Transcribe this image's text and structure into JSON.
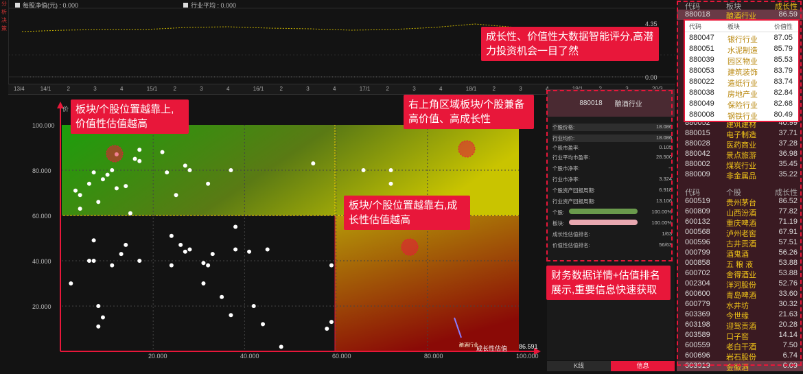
{
  "top_legend": {
    "eps_label": "每股净值(元) : 0.000",
    "avg_label": "行业平均 : 0.000"
  },
  "left_rail": [
    "分",
    "析",
    "决",
    "策"
  ],
  "top_axis_right": [
    "4.35",
    "0.00"
  ],
  "date_axis": [
    "13/4",
    "14/1",
    "2",
    "3",
    "4",
    "15/1",
    "2",
    "3",
    "4",
    "16/1",
    "2",
    "3",
    "4",
    "17/1",
    "2",
    "3",
    "4",
    "18/1",
    "2",
    "3",
    "4",
    "19/1",
    "2",
    "3",
    "20/3"
  ],
  "scatter": {
    "y_axis_title": "价",
    "y_ticks": [
      "100.000",
      "80.000",
      "60.000",
      "40.000",
      "20.000"
    ],
    "x_ticks": [
      "20.000",
      "40.000",
      "60.000",
      "80.000",
      "100.000"
    ],
    "x_axis_title": "成长性估值",
    "x_readout": "86.591",
    "highlight_label": "酿酒行业"
  },
  "callouts": {
    "top_right": "成长性、价值性大数据智能评分,高潜力投资机会一目了然",
    "upper_left": "板块/个股位置越靠上,价值性估值越高",
    "upper_right": "右上角区域板块/个股兼备高价值、高成长性",
    "middle": "板块/个股位置越靠右,成长性估值越高",
    "bottom_right": "财务数据详情+估值排名展示,重要信息快速获取"
  },
  "info_panel": {
    "code": "880018",
    "name": "酿酒行业",
    "rows": [
      {
        "label": "个股价格:",
        "value": "18.086"
      },
      {
        "label": "行业均价:",
        "value": "18.086"
      },
      {
        "label": "个股市盈率:",
        "value": "0.105"
      },
      {
        "label": "行业平均市盈率:",
        "value": "28.500"
      },
      {
        "label": "个股市净率:",
        "value": "--"
      },
      {
        "label": "行业市净率:",
        "value": "3.324"
      },
      {
        "label": "个股资产回报周期:",
        "value": "6.918"
      },
      {
        "label": "行业资产回报周期:",
        "value": "13.106"
      },
      {
        "label": "个股:",
        "value": "100.00%"
      },
      {
        "label": "板块:",
        "value": "100.00%"
      },
      {
        "label": "成长性估值排名:",
        "value": "1/63"
      },
      {
        "label": "价值性估值排名:",
        "value": "56/63"
      }
    ],
    "bar_individual": 1.0,
    "bar_sector": 1.0
  },
  "tabs": [
    "K线",
    "信息"
  ],
  "right_list": {
    "header": {
      "code": "代码",
      "sector": "板块",
      "score": "成长性"
    },
    "top_row": {
      "code": "880018",
      "name": "酿酒行业",
      "value": "86.59"
    },
    "popup_header": {
      "code": "代码",
      "sector": "板块",
      "score": "价值性"
    },
    "popup_rows": [
      {
        "code": "880047",
        "name": "银行行业",
        "value": "87.05"
      },
      {
        "code": "880051",
        "name": "水泥制造",
        "value": "85.79"
      },
      {
        "code": "880039",
        "name": "园区物业",
        "value": "85.53"
      },
      {
        "code": "880053",
        "name": "建筑装饰",
        "value": "83.79"
      },
      {
        "code": "880022",
        "name": "造纸行业",
        "value": "83.74"
      },
      {
        "code": "880038",
        "name": "房地产业",
        "value": "82.84"
      },
      {
        "code": "880049",
        "name": "保险行业",
        "value": "82.68"
      },
      {
        "code": "880008",
        "name": "钢铁行业",
        "value": "80.49"
      }
    ],
    "sector_rows": [
      {
        "code": "880052",
        "name": "建筑建材",
        "value": "40.99"
      },
      {
        "code": "880015",
        "name": "电子制造",
        "value": "37.71"
      },
      {
        "code": "880028",
        "name": "医药商业",
        "value": "37.28"
      },
      {
        "code": "880042",
        "name": "景点旅游",
        "value": "36.98"
      },
      {
        "code": "880002",
        "name": "煤炭行业",
        "value": "35.45"
      },
      {
        "code": "880009",
        "name": "非金属品",
        "value": "35.22"
      }
    ],
    "stock_header": {
      "code": "代码",
      "name": "个股",
      "score": "成长性"
    },
    "stock_rows": [
      {
        "code": "600519",
        "name": "贵州茅台",
        "value": "86.52"
      },
      {
        "code": "600809",
        "name": "山西汾酒",
        "value": "77.82"
      },
      {
        "code": "600132",
        "name": "重庆啤酒",
        "value": "71.19"
      },
      {
        "code": "000568",
        "name": "泸州老窖",
        "value": "67.91"
      },
      {
        "code": "000596",
        "name": "古井贡酒",
        "value": "57.51"
      },
      {
        "code": "000799",
        "name": "酒鬼酒",
        "value": "56.26"
      },
      {
        "code": "000858",
        "name": "五 粮 液",
        "value": "53.88"
      },
      {
        "code": "600702",
        "name": "舍得酒业",
        "value": "53.88"
      },
      {
        "code": "002304",
        "name": "洋河股份",
        "value": "52.76"
      },
      {
        "code": "600600",
        "name": "青岛啤酒",
        "value": "33.60"
      },
      {
        "code": "600779",
        "name": "水井坊",
        "value": "30.32"
      },
      {
        "code": "603369",
        "name": "今世缘",
        "value": "21.63"
      },
      {
        "code": "603198",
        "name": "迎驾贡酒",
        "value": "20.28"
      },
      {
        "code": "603589",
        "name": "口子窖",
        "value": "14.14"
      },
      {
        "code": "600559",
        "name": "老白干酒",
        "value": "7.50"
      },
      {
        "code": "600696",
        "name": "岩石股份",
        "value": "6.74"
      },
      {
        "code": "603919",
        "name": "金徽酒",
        "value": "6.09"
      }
    ]
  },
  "colors": {
    "accent": "#e8173a",
    "gold": "#f0c419",
    "list_bg": "#3a1a22"
  }
}
